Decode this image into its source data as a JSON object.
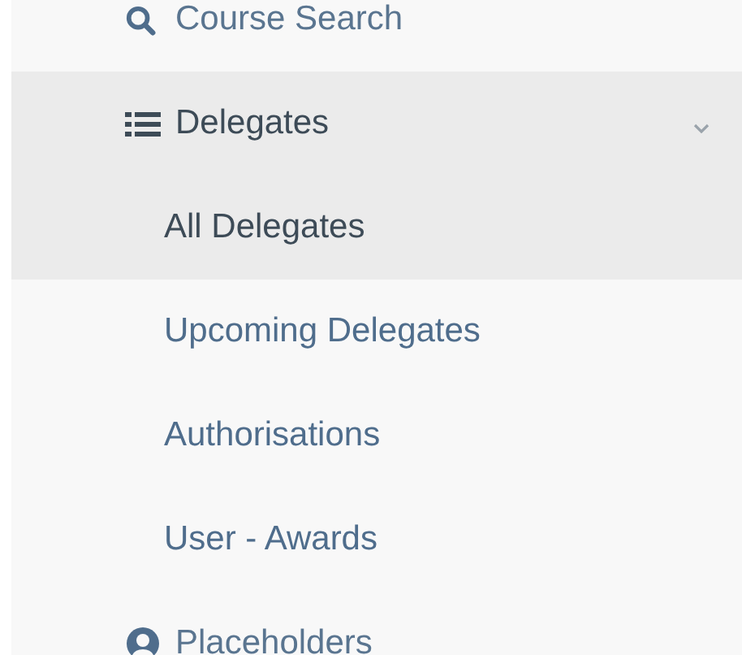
{
  "menu": [
    {
      "label": "Course Search",
      "selected": false
    },
    {
      "label": "Delegates",
      "selected": true,
      "expanded": true,
      "children": [
        {
          "label": "All Delegates",
          "selected": true
        },
        {
          "label": "Upcoming Delegates",
          "selected": false
        },
        {
          "label": "Authorisations",
          "selected": false
        },
        {
          "label": "User - Awards",
          "selected": false
        }
      ]
    },
    {
      "label": "Placeholders",
      "selected": false
    }
  ]
}
